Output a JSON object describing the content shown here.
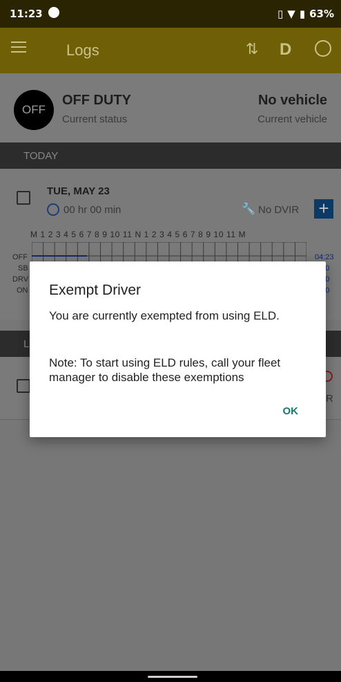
{
  "status_bar": {
    "time": "11:23",
    "battery": "63%"
  },
  "app_bar": {
    "title": "Logs",
    "duty_letter": "D"
  },
  "current": {
    "off_badge": "OFF",
    "status": "OFF DUTY",
    "status_label": "Current status",
    "vehicle": "No vehicle",
    "vehicle_label": "Current vehicle"
  },
  "section_today": "TODAY",
  "log": {
    "date": "TUE, MAY 23",
    "duration": "00 hr  00 min",
    "dvir": "No DVIR",
    "hours": "M 1 2 3 4 5 6 7 8 9 10 11 N 1 2 3 4 5 6 7 8 9 10 11 M",
    "rows": [
      {
        "label": "OFF",
        "total": "04:23"
      },
      {
        "label": "SB",
        "total": "0:00"
      },
      {
        "label": "DRV",
        "total": "0:00"
      },
      {
        "label": "ON",
        "total": "0:00"
      }
    ]
  },
  "section_last": "L",
  "card2_right": "R",
  "dialog": {
    "title": "Exempt Driver",
    "message": "You are currently exempted from using ELD.",
    "note": "Note: To start using ELD rules, call your fleet manager to disable these exemptions",
    "ok": "OK"
  }
}
